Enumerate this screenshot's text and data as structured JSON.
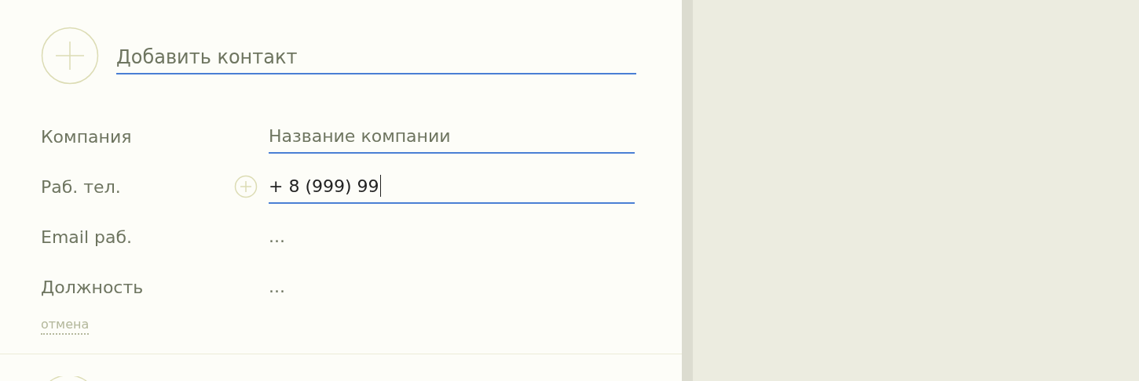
{
  "contact_title": {
    "placeholder": "Добавить контакт"
  },
  "fields": [
    {
      "label": "Компания",
      "placeholder": "Название компании",
      "active": true,
      "focused": false,
      "add_button": false
    },
    {
      "label": "Раб. тел.",
      "value": "+ 8 (999) 99",
      "active": true,
      "focused": true,
      "add_button": true
    },
    {
      "label": "Email раб.",
      "placeholder": "...",
      "active": false,
      "focused": false,
      "add_button": false
    },
    {
      "label": "Должность",
      "placeholder": "...",
      "active": false,
      "focused": false,
      "add_button": false
    }
  ],
  "cancel_link": "отмена"
}
